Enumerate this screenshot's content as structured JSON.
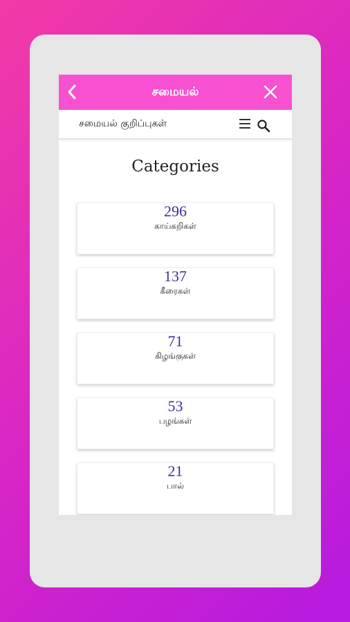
{
  "colors": {
    "brand": "#f751d2",
    "count_text": "#3b2fa6"
  },
  "appbar": {
    "title": "சமையல்",
    "back_icon": "chevron-left-icon",
    "close_icon": "close-icon"
  },
  "subbar": {
    "title": "சமையல் குறிப்புகள்",
    "menu_icon": "menu-icon",
    "search_icon": "search-icon"
  },
  "page": {
    "heading": "Categories"
  },
  "categories": [
    {
      "count": "296",
      "label": "காய்கறிகள்"
    },
    {
      "count": "137",
      "label": "கீரைகள்"
    },
    {
      "count": "71",
      "label": "கிழங்குகள்"
    },
    {
      "count": "53",
      "label": "பழங்கள்"
    },
    {
      "count": "21",
      "label": "பால்"
    }
  ]
}
